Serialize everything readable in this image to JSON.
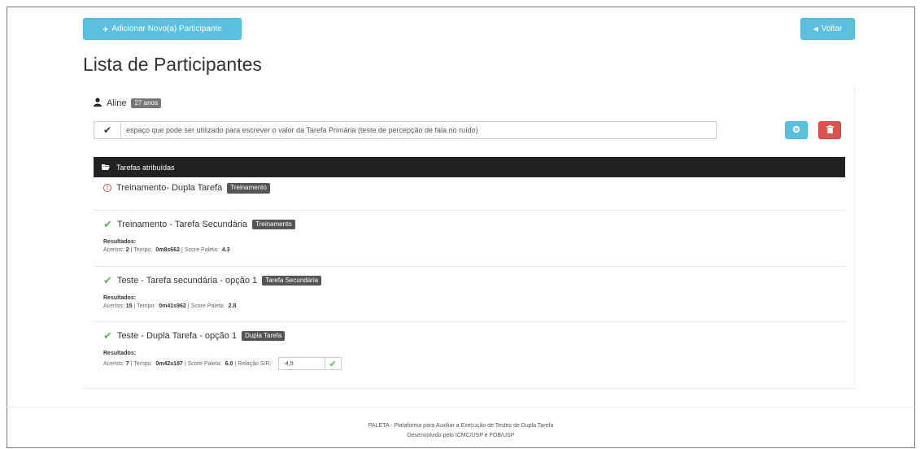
{
  "header": {
    "add_button_label": "Adicionar Novo(a) Participante",
    "back_button_label": "Voltar"
  },
  "page_title": "Lista de Participantes",
  "participant": {
    "name": "Aline",
    "age_badge": "27 anos",
    "note": "espaço que pode ser utilizado para escrever o valor da Tarefa Primária (teste de percepção de fala no ruído)"
  },
  "tasks_header": "Tarefas atribuídas",
  "tasks": [
    {
      "title": "Treinamento- Dupla Tarefa",
      "tag": "Treinamento"
    },
    {
      "title": "Treinamento - Tarefa Secundária",
      "tag": "Treinamento",
      "results_label": "Resultados:",
      "acertos_label": "Acertos:",
      "acertos": "2",
      "tempo_label": "Tempo:",
      "tempo": "0m8s662",
      "score_label": "Score Paleta:",
      "score": "4.3"
    },
    {
      "title": "Teste - Tarefa secundária - opção 1",
      "tag": "Tarefa Secundária",
      "results_label": "Resultados:",
      "acertos_label": "Acertos:",
      "acertos": "15",
      "tempo_label": "Tempo:",
      "tempo": "0m41s962",
      "score_label": "Score Paleta:",
      "score": "2.8"
    },
    {
      "title": "Teste - Dupla Tarefa - opção 1",
      "tag": "Dupla Tarefa",
      "results_label": "Resultados:",
      "acertos_label": "Acertos:",
      "acertos": "7",
      "tempo_label": "Tempo:",
      "tempo": "0m42s187",
      "score_label": "Score Paleta:",
      "score": "6.0",
      "ratio_label": "Relação S/R:",
      "ratio_value": "-4,5"
    }
  ],
  "footer": {
    "line1": "PALETA - Plataforma para Auxiliar a Execução de Testes de Dupla Tarefa",
    "line2": "Desenvolvido pelo ICMC/USP e FOB/USP"
  },
  "icons": {
    "add": "plus-icon",
    "back": "caret-left-icon",
    "user": "user-icon",
    "check": "check-icon",
    "gear": "gear-icon",
    "trash": "trash-icon",
    "folder": "folder-open-icon",
    "warning": "exclamation-circle-icon"
  },
  "colors": {
    "info": "#5bc0de",
    "danger": "#d9534f",
    "success": "#5cb85c",
    "dark_header": "#222222",
    "label_gray": "#777777"
  }
}
